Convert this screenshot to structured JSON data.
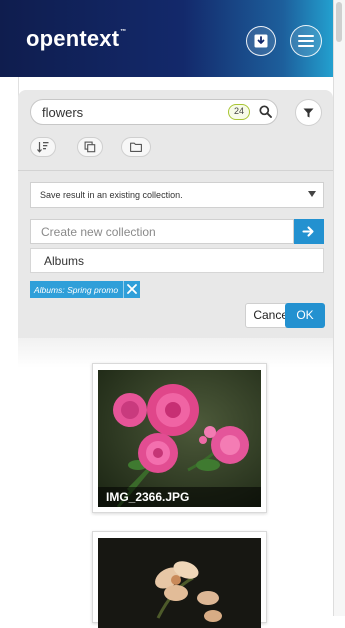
{
  "header": {
    "logo_text": "opentext",
    "logo_tm": "™",
    "download_icon": "download-icon",
    "menu_icon": "hamburger-menu-icon"
  },
  "search": {
    "value": "flowers",
    "result_count": "24",
    "icon": "search-icon",
    "filter_icon": "filter-icon"
  },
  "toolbar": {
    "sort_icon": "sort-icon",
    "copy_icon": "copy-icon",
    "folder_icon": "folder-icon"
  },
  "collection": {
    "select_value": "Save result in an existing collection.",
    "new_placeholder": "Create new collection",
    "options": [
      "Albums"
    ],
    "selected_tag": "Albums: Spring promo",
    "cancel_label": "Cancel",
    "ok_label": "OK"
  },
  "results": [
    {
      "filename": "IMG_2366.JPG"
    }
  ],
  "colors": {
    "accent": "#2391d0",
    "header_start": "#0f1d4e",
    "header_end": "#23a0cf",
    "badge_border": "#a9c634"
  }
}
